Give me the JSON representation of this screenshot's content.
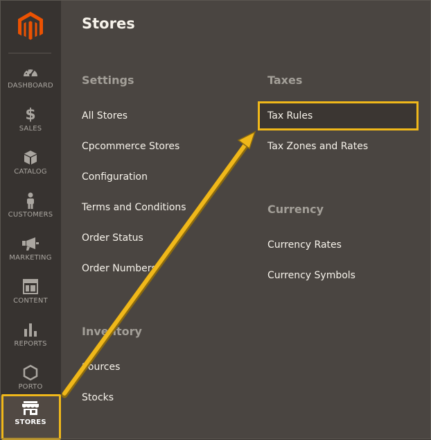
{
  "sidebar": {
    "logo": "magento-logo",
    "items": [
      {
        "label": "DASHBOARD",
        "icon": "dashboard-icon"
      },
      {
        "label": "SALES",
        "icon": "dollar-icon"
      },
      {
        "label": "CATALOG",
        "icon": "box-icon"
      },
      {
        "label": "CUSTOMERS",
        "icon": "person-icon"
      },
      {
        "label": "MARKETING",
        "icon": "megaphone-icon"
      },
      {
        "label": "CONTENT",
        "icon": "layout-icon"
      },
      {
        "label": "REPORTS",
        "icon": "bar-chart-icon"
      },
      {
        "label": "PORTO",
        "icon": "hexagon-icon"
      },
      {
        "label": "STORES",
        "icon": "storefront-icon"
      }
    ],
    "active": "STORES"
  },
  "panel": {
    "title": "Stores",
    "settings": {
      "heading": "Settings",
      "links": [
        "All Stores",
        "Cpcommerce Stores",
        "Configuration",
        "Terms and Conditions",
        "Order Status",
        "Order Numbers"
      ]
    },
    "inventory": {
      "heading": "Inventory",
      "links": [
        "Sources",
        "Stocks"
      ]
    },
    "taxes": {
      "heading": "Taxes",
      "links": [
        "Tax Rules",
        "Tax Zones and Rates"
      ]
    },
    "currency": {
      "heading": "Currency",
      "links": [
        "Currency Rates",
        "Currency Symbols"
      ]
    }
  },
  "colors": {
    "sidebar_bg": "#373330",
    "panel_bg": "#4a4541",
    "highlight": "#f0b81a",
    "brand": "#eb5202"
  }
}
